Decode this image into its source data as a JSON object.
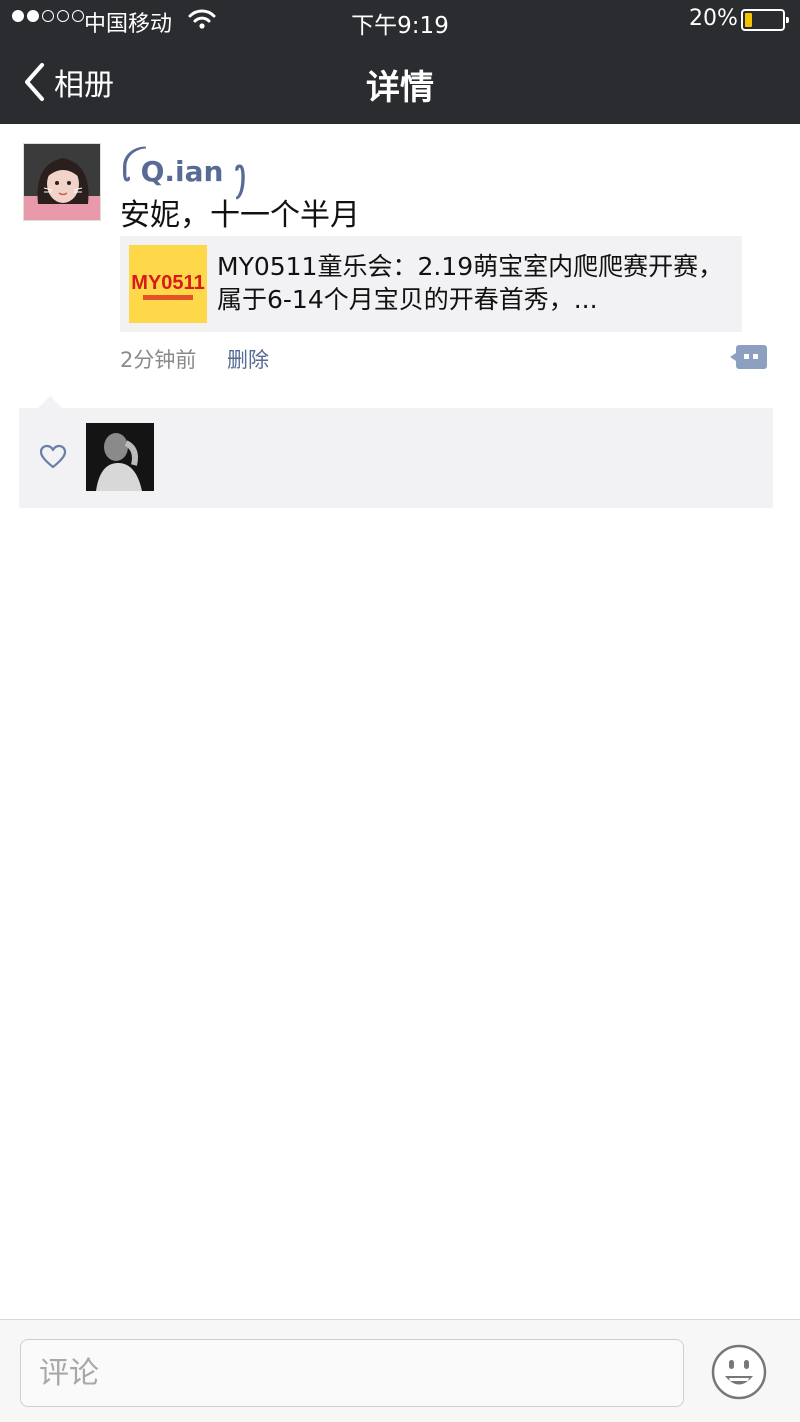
{
  "status_bar": {
    "carrier": "中国移动",
    "time": "下午9:19",
    "battery_percent": "20%",
    "battery_level": 0.2
  },
  "nav": {
    "back_label": "相册",
    "title": "详情"
  },
  "post": {
    "author": "ꪶ Q.ian ꫂ",
    "text": "安妮，十一个半月",
    "share": {
      "thumb_logo": "MY0511",
      "title": "MY0511童乐会：2.19萌宝室内爬爬赛开赛，属于6-14个月宝贝的开春首秀，..."
    },
    "timestamp": "2分钟前",
    "delete_label": "删除"
  },
  "colors": {
    "header_bg": "#2b2c30",
    "link_blue": "#576b95",
    "panel_bg": "#f2f2f4"
  },
  "icons": [
    "back-chevron-icon",
    "wifi-icon",
    "battery-icon",
    "comment-bubble-icon",
    "heart-icon",
    "emoji-icon"
  ],
  "comment_bar": {
    "placeholder": "评论"
  }
}
